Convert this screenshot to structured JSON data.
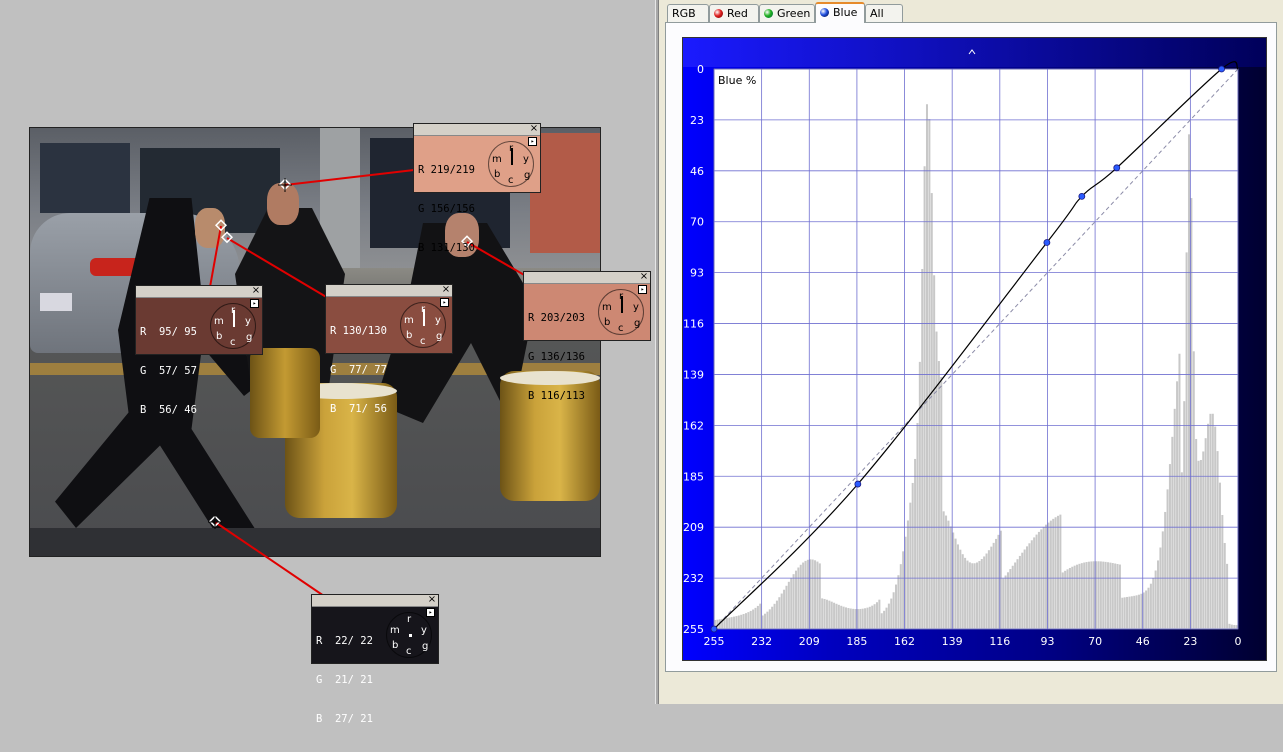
{
  "tabs": [
    {
      "label": "RGB",
      "dot": ""
    },
    {
      "label": "Red",
      "dot": "#e02020"
    },
    {
      "label": "Green",
      "dot": "#20b020"
    },
    {
      "label": "Blue",
      "dot": "#2050e0",
      "active": true
    },
    {
      "label": "All",
      "dot": ""
    }
  ],
  "probes": [
    {
      "id": "face-top",
      "r": "R 219/219",
      "g": "G 156/156",
      "b": "B 131/130",
      "bg": "#dfa088",
      "dark": false,
      "close": "×",
      "menu": "▸",
      "dial": {
        "m": "m",
        "r": "r",
        "y": "y",
        "b": "b",
        "c": "c",
        "g": "g"
      }
    },
    {
      "id": "face-left",
      "r": "R  95/ 95",
      "g": "G  57/ 57",
      "b": "B  56/ 46",
      "bg": "#6a3a32",
      "dark": true,
      "close": "×",
      "menu": "▸",
      "dial": {
        "m": "m",
        "r": "r",
        "y": "y",
        "b": "b",
        "c": "c",
        "g": "g"
      }
    },
    {
      "id": "face-mid",
      "r": "R 130/130",
      "g": "G  77/ 77",
      "b": "B  71/ 56",
      "bg": "#8a4d40",
      "dark": true,
      "close": "×",
      "menu": "▸",
      "dial": {
        "m": "m",
        "r": "r",
        "y": "y",
        "b": "b",
        "c": "c",
        "g": "g"
      }
    },
    {
      "id": "face-right",
      "r": "R 203/203",
      "g": "G 136/136",
      "b": "B 116/113",
      "bg": "#cd8873",
      "dark": false,
      "close": "×",
      "menu": "▸",
      "dial": {
        "m": "m",
        "r": "r",
        "y": "y",
        "b": "b",
        "c": "c",
        "g": "g"
      }
    },
    {
      "id": "shadow",
      "r": "R  22/ 22",
      "g": "G  21/ 21",
      "b": "B  27/ 21",
      "bg": "#16151b",
      "dark": true,
      "close": "×",
      "menu": "▸",
      "dial": {
        "m": "m",
        "r": "r",
        "y": "y",
        "b": "b",
        "c": "c",
        "g": "g"
      }
    }
  ],
  "chart_data": {
    "type": "line",
    "title": "Blue %",
    "channel": "Blue",
    "x_ticks": [
      "255",
      "232",
      "209",
      "185",
      "162",
      "139",
      "116",
      "93",
      "70",
      "46",
      "23",
      "0"
    ],
    "y_ticks": [
      "0",
      "23",
      "46",
      "70",
      "93",
      "116",
      "139",
      "162",
      "185",
      "209",
      "232",
      "255"
    ],
    "xlim": [
      255,
      0
    ],
    "ylim": [
      0,
      255
    ],
    "grid": true,
    "curve_points": [
      [
        255,
        255
      ],
      [
        185,
        189
      ],
      [
        93,
        79
      ],
      [
        76,
        58
      ],
      [
        59,
        45
      ],
      [
        8,
        0
      ]
    ],
    "identity_line": true,
    "histogram_color": "#c8c8c8",
    "curve_color": "#000000",
    "point_color": "#2a5bff"
  }
}
